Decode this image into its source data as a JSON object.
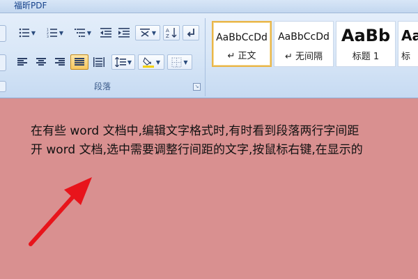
{
  "tabbar": {
    "tab_label": "福昕PDF"
  },
  "paragraph_group": {
    "label": "段落",
    "buttons": [
      {
        "id": "bullets",
        "icon": "bullets-icon"
      },
      {
        "id": "numbering",
        "icon": "numbering-icon"
      },
      {
        "id": "multilevel-list",
        "icon": "multilevel-list-icon"
      },
      {
        "id": "decrease-indent",
        "icon": "decrease-indent-icon"
      },
      {
        "id": "increase-indent",
        "icon": "increase-indent-icon"
      },
      {
        "id": "chinese-layout",
        "icon": "chinese-layout-icon"
      },
      {
        "id": "sort",
        "icon": "sort-icon"
      },
      {
        "id": "show-marks",
        "icon": "paragraph-mark-icon"
      },
      {
        "id": "align-left",
        "icon": "align-left-icon"
      },
      {
        "id": "align-center",
        "icon": "align-center-icon"
      },
      {
        "id": "align-right",
        "icon": "align-right-icon"
      },
      {
        "id": "justify",
        "icon": "justify-icon",
        "active": true
      },
      {
        "id": "distributed",
        "icon": "distributed-icon"
      },
      {
        "id": "line-spacing",
        "icon": "line-spacing-icon"
      },
      {
        "id": "shading",
        "icon": "shading-icon"
      },
      {
        "id": "borders",
        "icon": "borders-icon"
      }
    ]
  },
  "styles_group": {
    "styles": [
      {
        "sample": "AaBbCcDd",
        "name": "↵ 正文",
        "selected": true
      },
      {
        "sample": "AaBbCcDd",
        "name": "↵ 无间隔",
        "selected": false
      },
      {
        "sample": "AaBb",
        "name": "标题 1",
        "selected": false
      },
      {
        "sample": "Aa",
        "name": "标",
        "selected": false
      }
    ]
  },
  "document": {
    "lines": [
      "在有些 word 文档中,编辑文字格式时,有时看到段落两行字间距",
      "开 word 文档,选中需要调整行间距的文字,按鼠标右键,在显示的"
    ]
  },
  "colors": {
    "document_bg": "#d99090",
    "arrow": "#e8141b",
    "active_button": "#f7c75e"
  }
}
